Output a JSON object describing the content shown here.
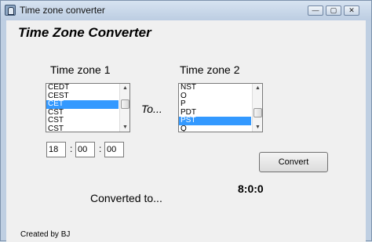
{
  "window": {
    "title": "Time zone converter",
    "controls": {
      "minimize": "—",
      "maximize": "▢",
      "close": "✕"
    }
  },
  "app": {
    "heading": "Time Zone Converter"
  },
  "zone1": {
    "label": "Time zone 1",
    "items": [
      "CEDT",
      "CEST",
      "CET",
      "CST",
      "CST",
      "CST"
    ],
    "selected": "CET"
  },
  "zone2": {
    "label": "Time zone 2",
    "items": [
      "NST",
      "O",
      "P",
      "PDT",
      "PST",
      "Q"
    ],
    "selected": "PST"
  },
  "connector": "To...",
  "time": {
    "hours": "18",
    "minutes": "00",
    "seconds": "00",
    "separator": ":"
  },
  "convert": {
    "label": "Convert"
  },
  "result": {
    "label": "Converted to...",
    "value": "8:0:0"
  },
  "footer": "Created by BJ"
}
